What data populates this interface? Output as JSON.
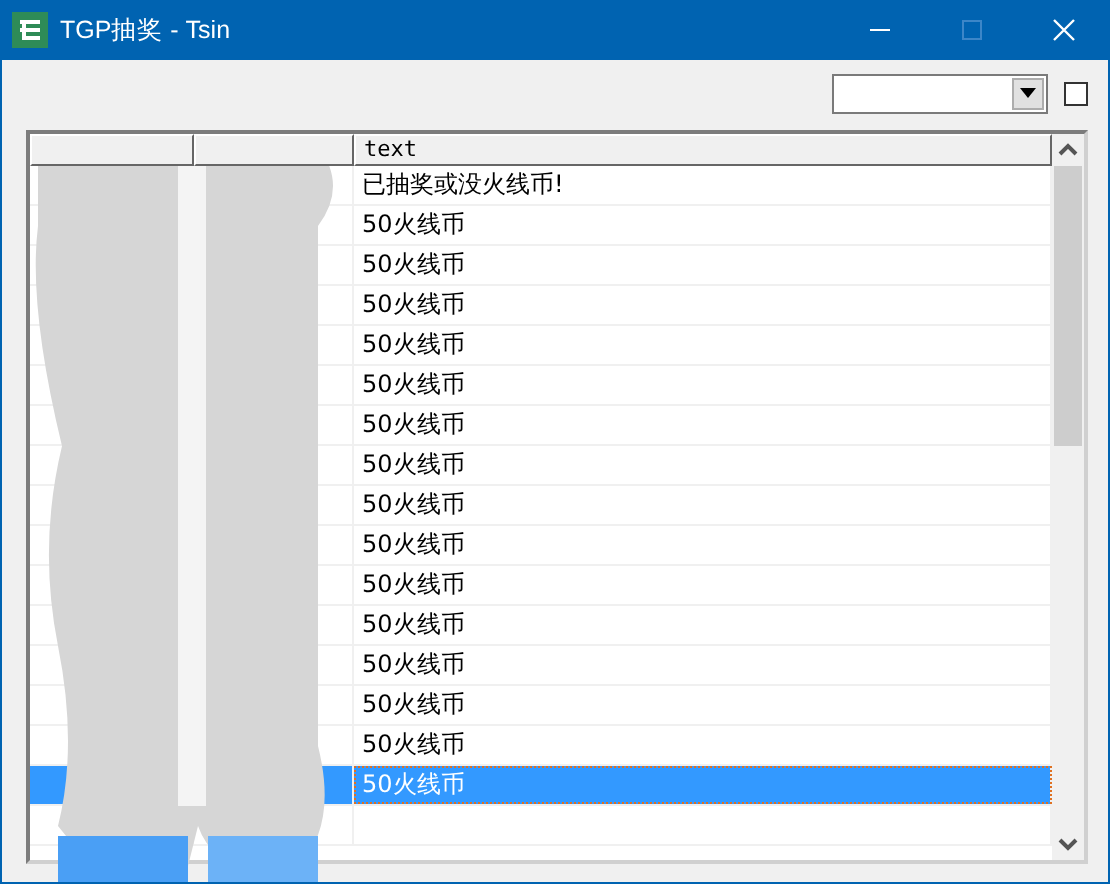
{
  "window": {
    "title": "TGP抽奖 - Tsin"
  },
  "filter": {
    "checkbox": {
      "checked": false
    }
  },
  "table": {
    "columns": [
      {
        "label": "text"
      }
    ],
    "rows": [
      {
        "text": "已抽奖或没火线币!",
        "selected": false
      },
      {
        "text": "50火线币",
        "selected": false
      },
      {
        "text": "50火线币",
        "selected": false
      },
      {
        "text": "50火线币",
        "selected": false
      },
      {
        "text": "50火线币",
        "selected": false
      },
      {
        "text": "50火线币",
        "selected": false
      },
      {
        "text": "50火线币",
        "selected": false
      },
      {
        "text": "50火线币",
        "selected": false
      },
      {
        "text": "50火线币",
        "selected": false
      },
      {
        "text": "50火线币",
        "selected": false
      },
      {
        "text": "50火线币",
        "selected": false
      },
      {
        "text": "50火线币",
        "selected": false
      },
      {
        "text": "50火线币",
        "selected": false
      },
      {
        "text": "50火线币",
        "selected": false
      },
      {
        "text": "50火线币",
        "selected": false
      },
      {
        "text": "50火线币",
        "selected": true
      }
    ]
  }
}
